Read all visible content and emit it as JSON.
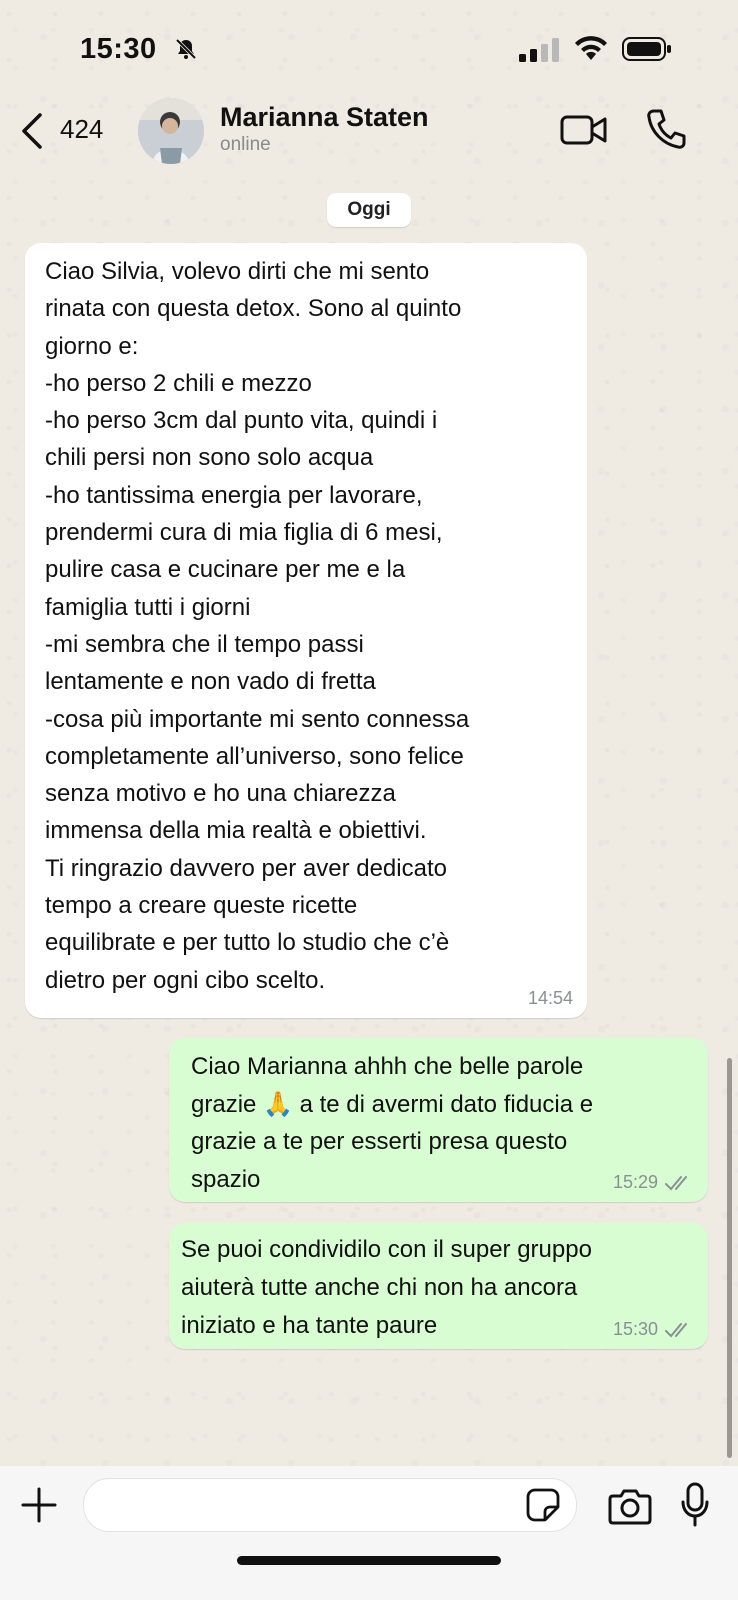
{
  "status_bar": {
    "time": "15:30"
  },
  "header": {
    "back_count": "424",
    "contact_name": "Marianna Staten",
    "contact_status": "online"
  },
  "chat": {
    "date_separator": "Oggi",
    "messages": [
      {
        "direction": "incoming",
        "text": "Ciao Silvia, volevo dirti che mi sento\nrinata con questa detox. Sono al quinto\ngiorno e:\n-ho perso 2 chili e mezzo\n-ho perso 3cm dal punto vita, quindi i\nchili persi non sono solo acqua\n-ho tantissima energia per lavorare,\nprendermi cura di mia figlia di 6 mesi,\npulire casa e cucinare per me e la\nfamiglia tutti i giorni\n-mi sembra che il tempo passi\nlentamente e non vado di fretta\n-cosa più importante mi sento connessa\ncompletamente all’universo, sono felice\nsenza motivo e ho una chiarezza\nimmensa della mia realtà e obiettivi.\nTi ringrazio davvero per aver dedicato\ntempo a creare queste ricette\nequilibrate e per tutto lo studio che c’è\ndietro per ogni cibo scelto.",
        "time": "14:54"
      },
      {
        "direction": "outgoing",
        "text": "Ciao Marianna ahhh che belle parole\ngrazie 🙏 a te di avermi dato fiducia e\ngrazie a te per esserti presa questo\nspazio",
        "time": "15:29",
        "status": "read"
      },
      {
        "direction": "outgoing",
        "text": "Se puoi condividilo con il super gruppo\naiuterà tutte anche chi non ha ancora\niniziato e ha tante paure",
        "time": "15:30",
        "status": "read"
      }
    ]
  },
  "input_bar": {
    "message_value": "",
    "message_placeholder": ""
  },
  "colors": {
    "outgoing_bubble": "#d9fdd3",
    "incoming_bubble": "#ffffff",
    "chat_background": "#efeae2",
    "read_ticks": "#8a8f92"
  },
  "icons": [
    "bell-slash-icon",
    "signal-icon",
    "wifi-icon",
    "battery-icon",
    "chevron-left-icon",
    "video-camera-icon",
    "phone-icon",
    "plus-icon",
    "sticker-icon",
    "camera-icon",
    "microphone-icon",
    "double-check-icon"
  ]
}
